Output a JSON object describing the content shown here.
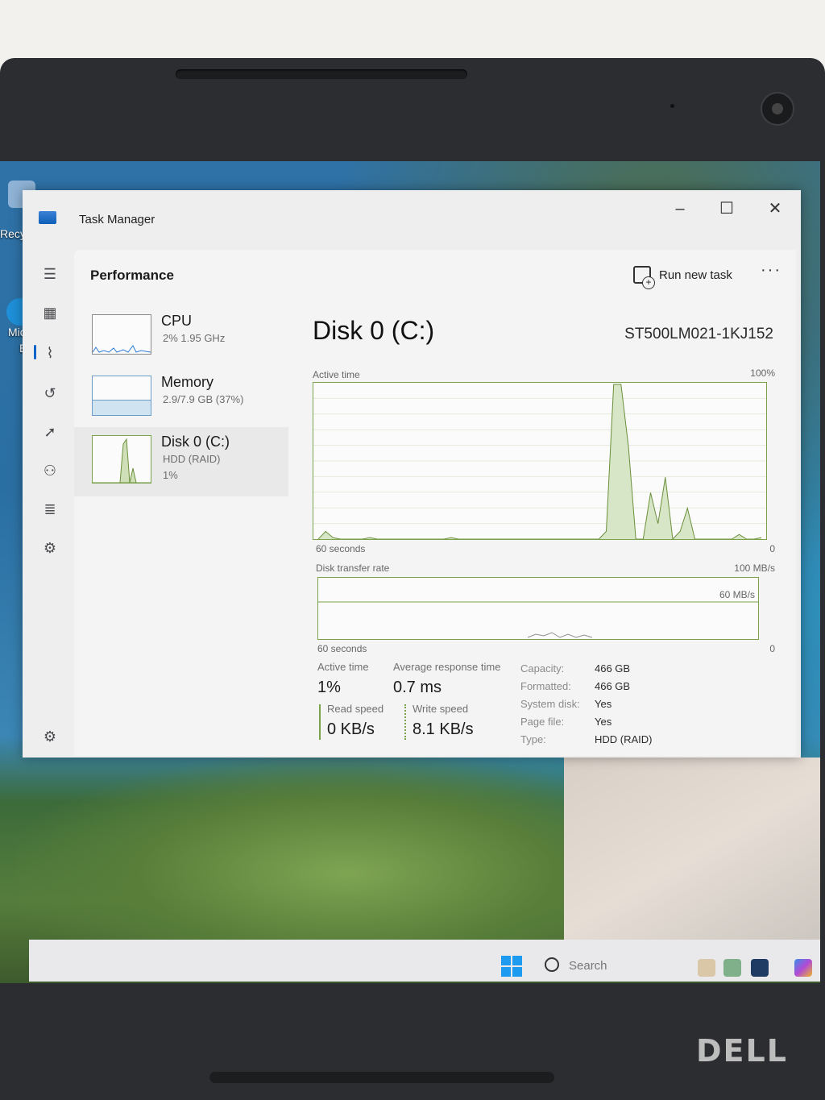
{
  "window": {
    "title": "Task Manager"
  },
  "nav": {
    "items": [
      "menu",
      "processes",
      "performance",
      "app-history",
      "startup-apps",
      "users",
      "details",
      "services"
    ],
    "active": "performance"
  },
  "header": {
    "title": "Performance",
    "run_new_task": "Run new task",
    "more": "···"
  },
  "devices": [
    {
      "name": "CPU",
      "sub": "2% 1.95 GHz",
      "sub2": ""
    },
    {
      "name": "Memory",
      "sub": "2.9/7.9 GB (37%)",
      "sub2": ""
    },
    {
      "name": "Disk 0 (C:)",
      "sub": "HDD (RAID)",
      "sub2": "1%"
    }
  ],
  "disk": {
    "title": "Disk 0 (C:)",
    "model": "ST500LM021-1KJ152",
    "active_time_label": "Active time",
    "active_time_max": "100%",
    "active_time_xlabel": "60 seconds",
    "active_time_xmin": "0",
    "transfer_label": "Disk transfer rate",
    "transfer_max": "100 MB/s",
    "transfer_mid": "60 MB/s",
    "transfer_xlabel": "60 seconds",
    "transfer_xmin": "0"
  },
  "stats": {
    "active_time_label": "Active time",
    "active_time_value": "1%",
    "avg_response_label": "Average response time",
    "avg_response_value": "0.7 ms",
    "read_speed_label": "Read speed",
    "read_speed_value": "0 KB/s",
    "write_speed_label": "Write speed",
    "write_speed_value": "8.1 KB/s"
  },
  "properties": [
    {
      "key": "Capacity:",
      "value": "466 GB"
    },
    {
      "key": "Formatted:",
      "value": "466 GB"
    },
    {
      "key": "System disk:",
      "value": "Yes"
    },
    {
      "key": "Page file:",
      "value": "Yes"
    },
    {
      "key": "Type:",
      "value": "HDD (RAID)"
    }
  ],
  "taskbar": {
    "search": "Search"
  },
  "desktop": {
    "labels": [
      "Recy",
      "Mic",
      "Ed"
    ]
  },
  "brand": "DELL",
  "chart_data": {
    "type": "area",
    "title": "Active time",
    "ylim": [
      0,
      100
    ],
    "y_unit": "%",
    "x_range_label": "60 seconds",
    "series": [
      {
        "values": [
          0,
          5,
          1,
          0,
          0,
          0,
          0,
          1,
          0,
          0,
          0,
          0,
          0,
          0,
          0,
          0,
          0,
          0,
          1,
          0,
          0,
          0,
          0,
          0,
          0,
          0,
          0,
          0,
          0,
          0,
          0,
          0,
          0,
          0,
          0,
          0,
          0,
          0,
          0,
          5,
          100,
          100,
          60,
          0,
          0,
          30,
          10,
          40,
          0,
          5,
          20,
          0,
          0,
          0,
          0,
          0,
          0,
          3,
          0,
          0,
          1
        ]
      }
    ]
  }
}
